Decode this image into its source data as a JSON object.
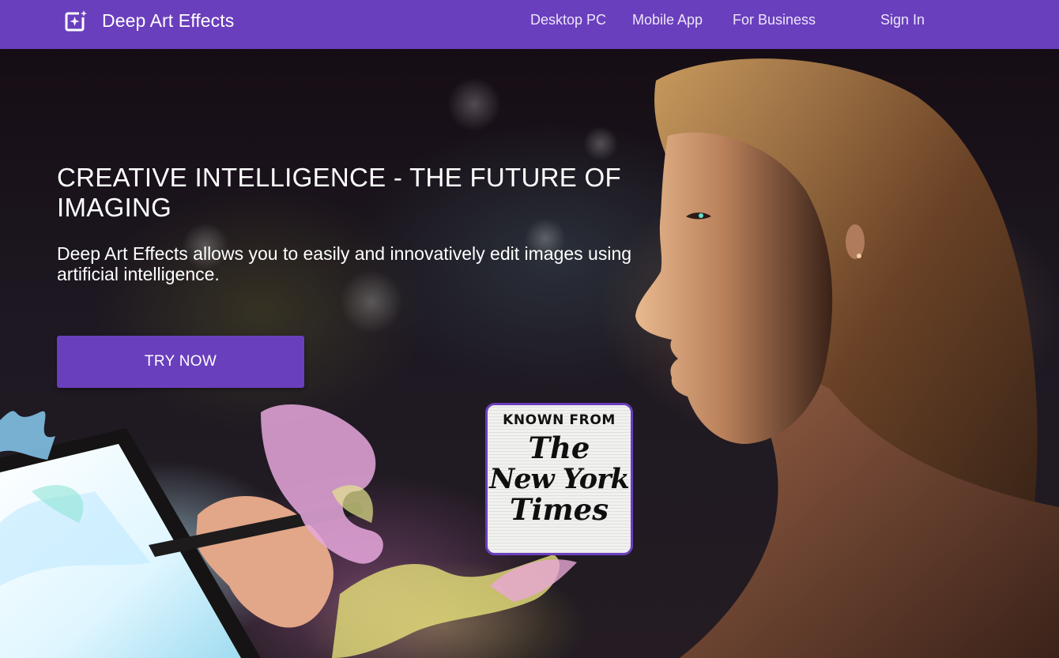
{
  "nav": {
    "brand": "Deep Art Effects",
    "links": [
      "Desktop PC",
      "Mobile App",
      "For Business"
    ],
    "sign_in": "Sign In",
    "color": "#6a3fbd"
  },
  "hero": {
    "title": "CREATIVE INTELLIGENCE - THE FUTURE OF IMAGING",
    "subtitle": "Deep Art Effects allows you to easily and innovatively edit images using artificial intelligence.",
    "cta": "TRY NOW"
  },
  "press_badge": {
    "heading": "KNOWN FROM",
    "masthead": [
      "The",
      "New York",
      "Times"
    ]
  }
}
